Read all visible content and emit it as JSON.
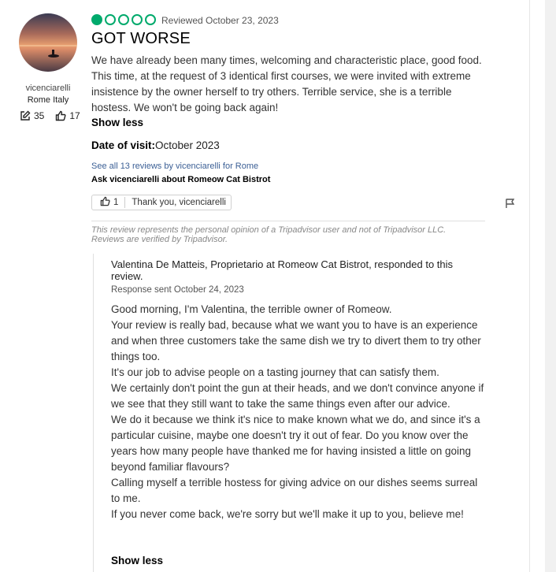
{
  "reviewer": {
    "username": "vicenciarelli",
    "location": "Rome Italy",
    "contributions": "35",
    "helpful_votes": "17"
  },
  "review": {
    "rating": 1,
    "rating_max": 5,
    "rating_color": "#00aa6c",
    "reviewed_date": "Reviewed October 23, 2023",
    "title": "GOT WORSE",
    "body": "We have already been many times, welcoming and characteristic place, good food. This time, at the request of 3 identical first courses, we were invited with extreme insistence by the owner herself to try others. Terrible service, she is a terrible hostess. We won't be going back again!",
    "show_less": "Show less",
    "visit_label": "Date of visit:",
    "visit_value": "October 2023",
    "see_all_link": "See all 13 reviews by vicenciarelli for Rome",
    "ask_link": "Ask vicenciarelli about Romeow Cat Bistrot",
    "helpful_count": "1",
    "thank_label": "Thank you, vicenciarelli",
    "disclaimer": "This review represents the personal opinion of a Tripadvisor user and not of Tripadvisor LLC. Reviews are verified by Tripadvisor."
  },
  "response": {
    "responder": "Valentina De Matteis, Proprietario at Romeow Cat Bistrot, responded to this review.",
    "date": "Response sent October 24, 2023",
    "paragraphs": [
      "Good morning, I'm Valentina, the terrible owner of Romeow.",
      "Your review is really bad, because what we want you to have is an experience and when three customers take the same dish we try to divert them to try other things too.",
      "It's our job to advise people on a tasting journey that can satisfy them.",
      "We certainly don't point the gun at their heads, and we don't convince anyone if we see that they still want to take the same things even after our advice.",
      "We do it because we think it's nice to make known what we do, and since it's a particular cuisine, maybe one doesn't try it out of fear. Do you know over the years how many people have thanked me for having insisted a little on going beyond familiar flavours?",
      "Calling myself a terrible hostess for giving advice on our dishes seems surreal to me.",
      "If you never come back, we're sorry but we'll make it up to you, believe me!"
    ],
    "show_less": "Show less"
  }
}
